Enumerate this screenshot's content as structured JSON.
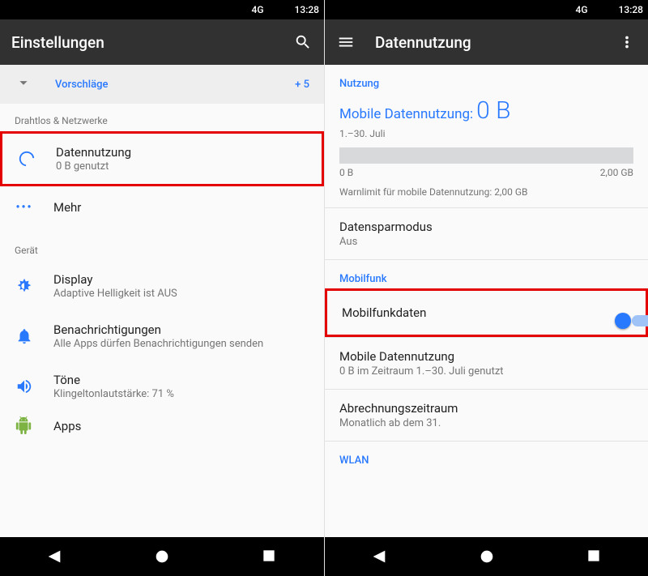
{
  "statusbar": {
    "network": "4G",
    "time": "13:28"
  },
  "left": {
    "title": "Einstellungen",
    "suggestions": {
      "label": "Vorschläge",
      "count": "+ 5"
    },
    "sections": {
      "wireless": "Drahtlos & Netzwerke",
      "device": "Gerät"
    },
    "items": {
      "data": {
        "title": "Datennutzung",
        "sub": "0 B genutzt"
      },
      "more": {
        "title": "Mehr"
      },
      "display": {
        "title": "Display",
        "sub": "Adaptive Helligkeit ist AUS"
      },
      "notif": {
        "title": "Benachrichtigungen",
        "sub": "Alle Apps dürfen Benachrichtigungen senden"
      },
      "sound": {
        "title": "Töne",
        "sub": "Klingeltonlautstärke: 71 %"
      },
      "apps": {
        "title": "Apps"
      }
    }
  },
  "right": {
    "title": "Datennutzung",
    "sections": {
      "usage": "Nutzung",
      "mobile": "Mobilfunk",
      "wlan": "WLAN"
    },
    "usage": {
      "label": "Mobile Datennutzung:",
      "value": "0 B",
      "range": "1.–30. Juli",
      "min": "0 B",
      "max": "2,00 GB",
      "warn": "Warnlimit für mobile Datennutzung: 2,00 GB"
    },
    "saver": {
      "title": "Datensparmodus",
      "sub": "Aus"
    },
    "cell": {
      "title": "Mobilfunkdaten",
      "on": true
    },
    "mobusage": {
      "title": "Mobile Datennutzung",
      "sub": "0 B im Zeitraum 1.–30. Juli genutzt"
    },
    "cycle": {
      "title": "Abrechnungszeitraum",
      "sub": "Monatlich ab dem 31."
    }
  }
}
